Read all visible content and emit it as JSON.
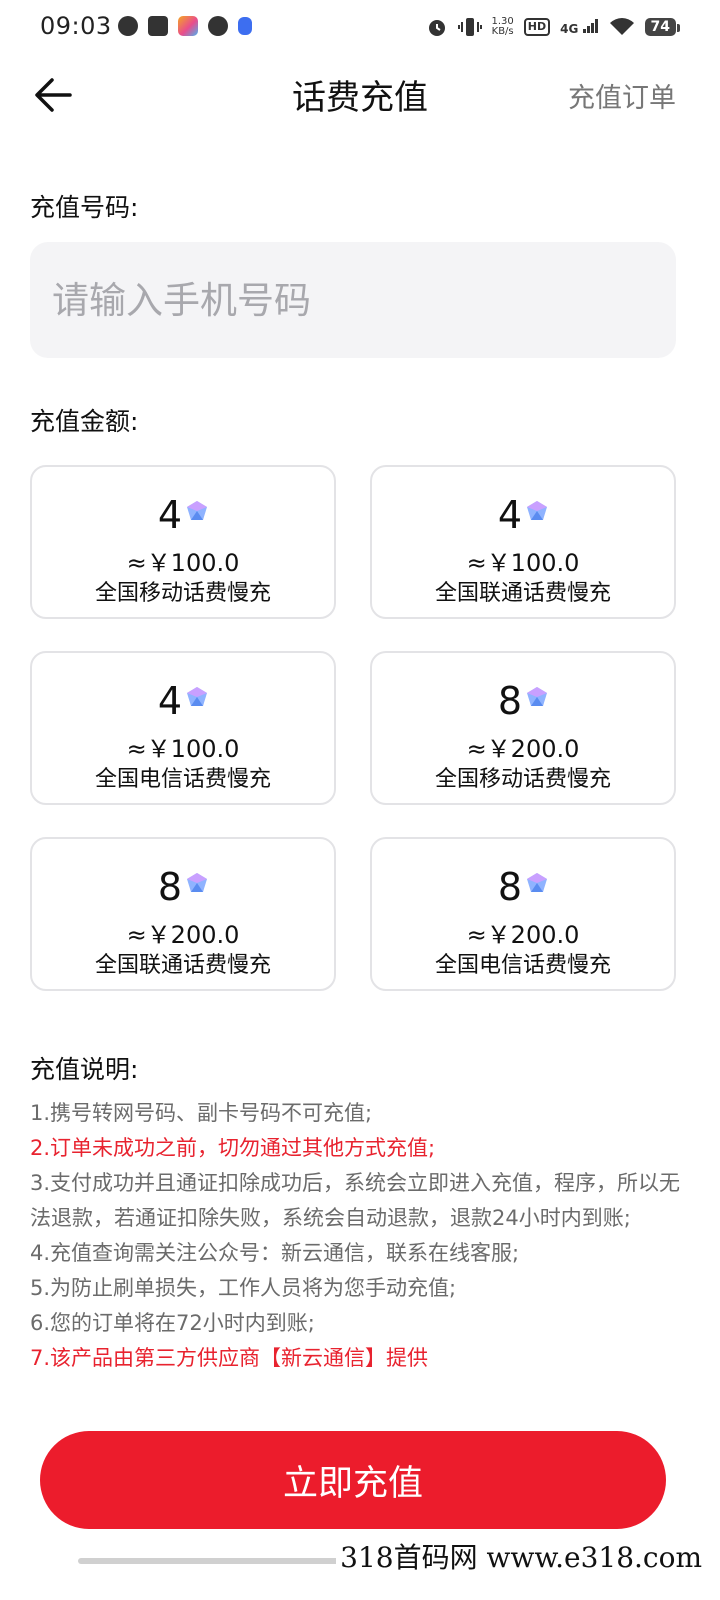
{
  "status_bar": {
    "time": "09:03",
    "net_speed_value": "1.30",
    "net_speed_unit": "KB/s",
    "hd": "HD",
    "network": "4G",
    "battery": "74"
  },
  "header": {
    "title": "话费充值",
    "orders_label": "充值订单"
  },
  "phone": {
    "label": "充值号码:",
    "placeholder": "请输入手机号码",
    "value": ""
  },
  "amount": {
    "label": "充值金额:",
    "options": [
      {
        "gems": "4",
        "price": "≈￥100.0",
        "name": "全国移动话费慢充"
      },
      {
        "gems": "4",
        "price": "≈￥100.0",
        "name": "全国联通话费慢充"
      },
      {
        "gems": "4",
        "price": "≈￥100.0",
        "name": "全国电信话费慢充"
      },
      {
        "gems": "8",
        "price": "≈￥200.0",
        "name": "全国移动话费慢充"
      },
      {
        "gems": "8",
        "price": "≈￥200.0",
        "name": "全国联通话费慢充"
      },
      {
        "gems": "8",
        "price": "≈￥200.0",
        "name": "全国电信话费慢充"
      }
    ]
  },
  "notes": {
    "label": "充值说明:",
    "items": [
      "1.携号转网号码、副卡号码不可充值;",
      "2.订单未成功之前，切勿通过其他方式充值;",
      "3.支付成功并且通证扣除成功后，系统会立即进入充值，程序，所以无法退款，若通证扣除失败，系统会自动退款，退款24小时内到账;",
      "4.充值查询需关注公众号：新云通信，联系在线客服;",
      "5.为防止刷单损失，工作人员将为您手动充值;",
      "6.您的订单将在72小时内到账;",
      "7.该产品由第三方供应商【新云通信】提供"
    ]
  },
  "submit_label": "立即充值",
  "watermark": "318首码网 www.e318.com",
  "colors": {
    "accent_red": "#ec1c2c",
    "warning_red": "#e8232f",
    "input_bg": "#f4f4f6"
  }
}
